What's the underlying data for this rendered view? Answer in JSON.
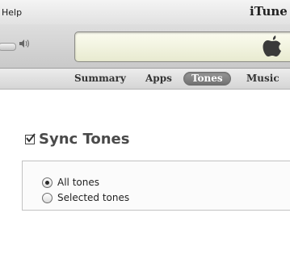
{
  "menubar": {
    "help_label": "Help",
    "app_title": "iTune"
  },
  "toolbar": {
    "volume_icon": "speaker-icon",
    "lcd_logo_icon": "apple-logo-icon"
  },
  "tabs": [
    {
      "label": "Summary",
      "selected": false
    },
    {
      "label": "Apps",
      "selected": false
    },
    {
      "label": "Tones",
      "selected": true
    },
    {
      "label": "Music",
      "selected": false
    }
  ],
  "sync": {
    "title": "Sync Tones",
    "checked": true,
    "options": [
      {
        "label": "All tones",
        "selected": true
      },
      {
        "label": "Selected tones",
        "selected": false
      }
    ]
  },
  "colors": {
    "selected_tab_bg": "#7a7a7a",
    "lcd_bg": "#f3f5e0",
    "title_text": "#4a4a4a"
  }
}
